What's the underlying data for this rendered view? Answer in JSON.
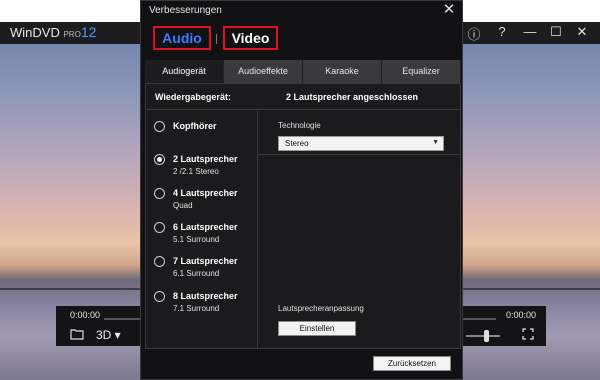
{
  "player": {
    "app_name": "WinDVD",
    "edition": "PRO",
    "version": "12",
    "window_buttons": [
      "ⓘ",
      "?",
      "—",
      "☐",
      "✕"
    ],
    "controls": {
      "time_left": "0:00:00",
      "time_right": "0:00:00",
      "mode_3d": "3D"
    }
  },
  "dialog": {
    "title": "Verbesserungen",
    "close": "✕",
    "main_tabs": [
      "Audio",
      "Video"
    ],
    "sub_tabs": [
      "Audiogerät",
      "Audioeffekte",
      "Karaoke",
      "Equalizer"
    ],
    "device_label": "Wiedergabegerät:",
    "device_value": "2 Lautsprecher angeschlossen",
    "speakers": [
      {
        "label": "Kopfhörer",
        "sub": "",
        "checked": false
      },
      {
        "label": "2 Lautsprecher",
        "sub": "2 /2.1 Stereo",
        "checked": true
      },
      {
        "label": "4 Lautsprecher",
        "sub": "Quad",
        "checked": false
      },
      {
        "label": "6 Lautsprecher",
        "sub": "5.1 Surround",
        "checked": false
      },
      {
        "label": "7 Lautsprecher",
        "sub": "6.1 Surround",
        "checked": false
      },
      {
        "label": "8 Lautsprecher",
        "sub": "7.1 Surround",
        "checked": false
      }
    ],
    "technology_label": "Technologie",
    "technology_value": "Stereo",
    "adjust_label": "Lautsprecheranpassung",
    "adjust_button": "Einstellen",
    "reset_button": "Zurücksetzen"
  },
  "colors": {
    "audio_tab": "#3a7bff",
    "highlight_border": "#e01020"
  }
}
